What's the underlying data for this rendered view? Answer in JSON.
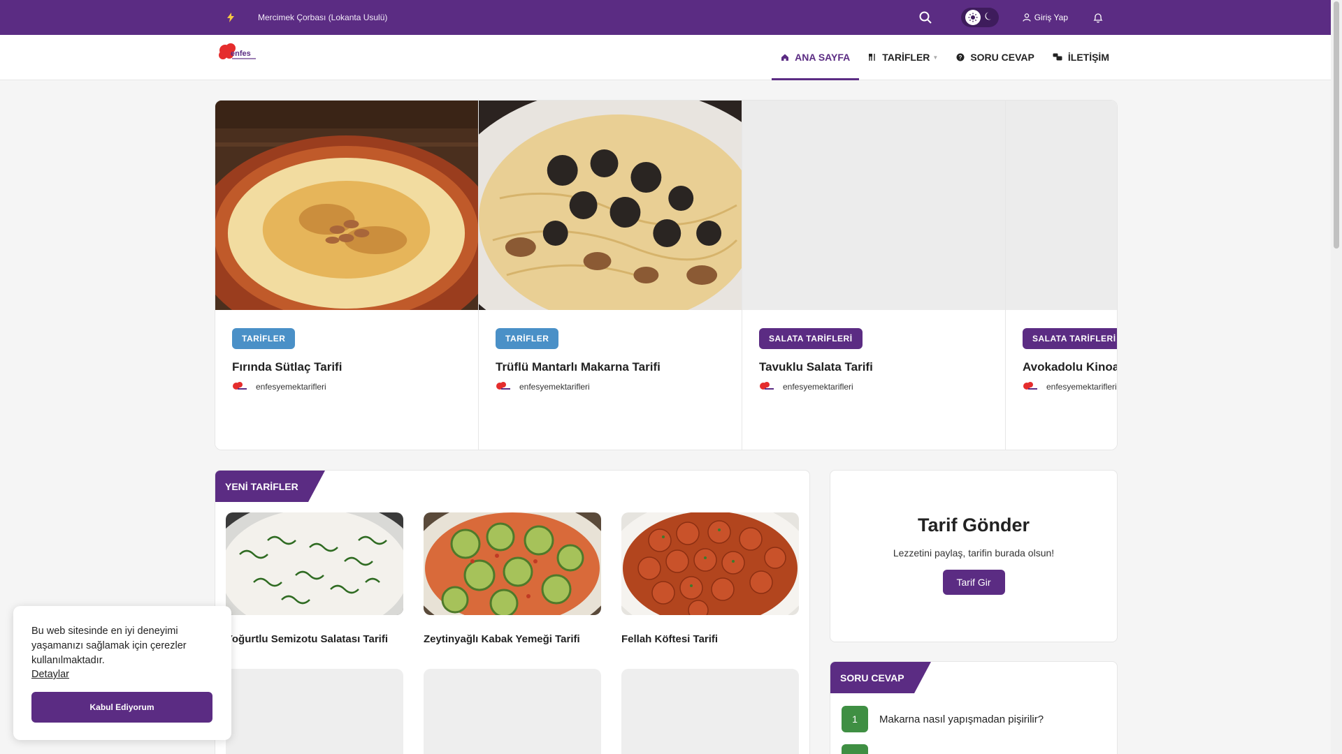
{
  "topbar": {
    "ticker": "Mercimek Çorbası (Lokanta Usulü)",
    "login_label": "Giriş Yap"
  },
  "navbar": {
    "menu": [
      {
        "label": "ANA SAYFA"
      },
      {
        "label": "TARİFLER"
      },
      {
        "label": "SORU CEVAP"
      },
      {
        "label": "İLETİŞİM"
      }
    ]
  },
  "slider": {
    "slides": [
      {
        "category": "TARİFLER",
        "title": "Fırında Sütlaç Tarifi",
        "author": "enfesyemektarifleri"
      },
      {
        "category": "TARİFLER",
        "title": "Trüflü Mantarlı Makarna Tarifi",
        "author": "enfesyemektarifleri"
      },
      {
        "category": "SALATA TARİFLERİ",
        "title": "Tavuklu Salata Tarifi",
        "author": "enfesyemektarifleri"
      },
      {
        "category": "SALATA TARİFLERİ",
        "title": "Avokadolu Kinoa",
        "author": "enfesyemektarifleri"
      }
    ]
  },
  "new_recipes": {
    "heading": "YENİ TARİFLER",
    "cards": [
      {
        "title": "Yoğurtlu Semizotu Salatası Tarifi"
      },
      {
        "title": "Zeytinyağlı Kabak Yemeği Tarifi"
      },
      {
        "title": "Fellah Köftesi Tarifi"
      }
    ]
  },
  "submit_box": {
    "title": "Tarif Gönder",
    "subtitle": "Lezzetini paylaş, tarifin burada olsun!",
    "button": "Tarif Gir"
  },
  "qa_box": {
    "heading": "SORU CEVAP",
    "items": [
      {
        "num": "1",
        "question": "Makarna nasıl yapışmadan pişirilir?"
      },
      {
        "num": "",
        "question": ""
      }
    ]
  },
  "cookie": {
    "text": "Bu web sitesinde en iyi deneyimi yaşamanızı sağlamak için çerezler kullanılmaktadır.",
    "details": "Detaylar",
    "accept": "Kabul Ediyorum"
  },
  "colors": {
    "brand_purple": "#5b2c83",
    "category_blue": "#4a90c7",
    "qa_green": "#3f8f43"
  }
}
